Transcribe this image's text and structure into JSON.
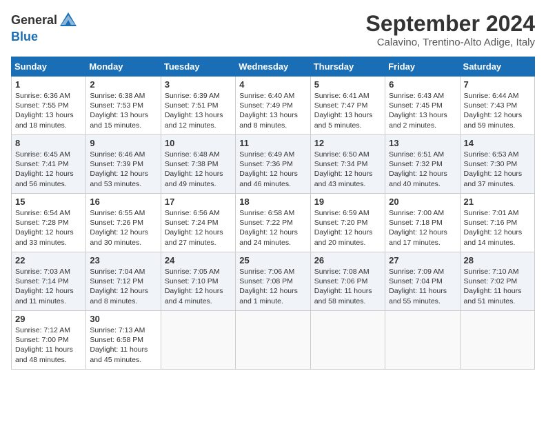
{
  "header": {
    "logo_line1": "General",
    "logo_line2": "Blue",
    "month_title": "September 2024",
    "location": "Calavino, Trentino-Alto Adige, Italy"
  },
  "weekdays": [
    "Sunday",
    "Monday",
    "Tuesday",
    "Wednesday",
    "Thursday",
    "Friday",
    "Saturday"
  ],
  "weeks": [
    [
      {
        "day": "1",
        "lines": [
          "Sunrise: 6:36 AM",
          "Sunset: 7:55 PM",
          "Daylight: 13 hours",
          "and 18 minutes."
        ]
      },
      {
        "day": "2",
        "lines": [
          "Sunrise: 6:38 AM",
          "Sunset: 7:53 PM",
          "Daylight: 13 hours",
          "and 15 minutes."
        ]
      },
      {
        "day": "3",
        "lines": [
          "Sunrise: 6:39 AM",
          "Sunset: 7:51 PM",
          "Daylight: 13 hours",
          "and 12 minutes."
        ]
      },
      {
        "day": "4",
        "lines": [
          "Sunrise: 6:40 AM",
          "Sunset: 7:49 PM",
          "Daylight: 13 hours",
          "and 8 minutes."
        ]
      },
      {
        "day": "5",
        "lines": [
          "Sunrise: 6:41 AM",
          "Sunset: 7:47 PM",
          "Daylight: 13 hours",
          "and 5 minutes."
        ]
      },
      {
        "day": "6",
        "lines": [
          "Sunrise: 6:43 AM",
          "Sunset: 7:45 PM",
          "Daylight: 13 hours",
          "and 2 minutes."
        ]
      },
      {
        "day": "7",
        "lines": [
          "Sunrise: 6:44 AM",
          "Sunset: 7:43 PM",
          "Daylight: 12 hours",
          "and 59 minutes."
        ]
      }
    ],
    [
      {
        "day": "8",
        "lines": [
          "Sunrise: 6:45 AM",
          "Sunset: 7:41 PM",
          "Daylight: 12 hours",
          "and 56 minutes."
        ]
      },
      {
        "day": "9",
        "lines": [
          "Sunrise: 6:46 AM",
          "Sunset: 7:39 PM",
          "Daylight: 12 hours",
          "and 53 minutes."
        ]
      },
      {
        "day": "10",
        "lines": [
          "Sunrise: 6:48 AM",
          "Sunset: 7:38 PM",
          "Daylight: 12 hours",
          "and 49 minutes."
        ]
      },
      {
        "day": "11",
        "lines": [
          "Sunrise: 6:49 AM",
          "Sunset: 7:36 PM",
          "Daylight: 12 hours",
          "and 46 minutes."
        ]
      },
      {
        "day": "12",
        "lines": [
          "Sunrise: 6:50 AM",
          "Sunset: 7:34 PM",
          "Daylight: 12 hours",
          "and 43 minutes."
        ]
      },
      {
        "day": "13",
        "lines": [
          "Sunrise: 6:51 AM",
          "Sunset: 7:32 PM",
          "Daylight: 12 hours",
          "and 40 minutes."
        ]
      },
      {
        "day": "14",
        "lines": [
          "Sunrise: 6:53 AM",
          "Sunset: 7:30 PM",
          "Daylight: 12 hours",
          "and 37 minutes."
        ]
      }
    ],
    [
      {
        "day": "15",
        "lines": [
          "Sunrise: 6:54 AM",
          "Sunset: 7:28 PM",
          "Daylight: 12 hours",
          "and 33 minutes."
        ]
      },
      {
        "day": "16",
        "lines": [
          "Sunrise: 6:55 AM",
          "Sunset: 7:26 PM",
          "Daylight: 12 hours",
          "and 30 minutes."
        ]
      },
      {
        "day": "17",
        "lines": [
          "Sunrise: 6:56 AM",
          "Sunset: 7:24 PM",
          "Daylight: 12 hours",
          "and 27 minutes."
        ]
      },
      {
        "day": "18",
        "lines": [
          "Sunrise: 6:58 AM",
          "Sunset: 7:22 PM",
          "Daylight: 12 hours",
          "and 24 minutes."
        ]
      },
      {
        "day": "19",
        "lines": [
          "Sunrise: 6:59 AM",
          "Sunset: 7:20 PM",
          "Daylight: 12 hours",
          "and 20 minutes."
        ]
      },
      {
        "day": "20",
        "lines": [
          "Sunrise: 7:00 AM",
          "Sunset: 7:18 PM",
          "Daylight: 12 hours",
          "and 17 minutes."
        ]
      },
      {
        "day": "21",
        "lines": [
          "Sunrise: 7:01 AM",
          "Sunset: 7:16 PM",
          "Daylight: 12 hours",
          "and 14 minutes."
        ]
      }
    ],
    [
      {
        "day": "22",
        "lines": [
          "Sunrise: 7:03 AM",
          "Sunset: 7:14 PM",
          "Daylight: 12 hours",
          "and 11 minutes."
        ]
      },
      {
        "day": "23",
        "lines": [
          "Sunrise: 7:04 AM",
          "Sunset: 7:12 PM",
          "Daylight: 12 hours",
          "and 8 minutes."
        ]
      },
      {
        "day": "24",
        "lines": [
          "Sunrise: 7:05 AM",
          "Sunset: 7:10 PM",
          "Daylight: 12 hours",
          "and 4 minutes."
        ]
      },
      {
        "day": "25",
        "lines": [
          "Sunrise: 7:06 AM",
          "Sunset: 7:08 PM",
          "Daylight: 12 hours",
          "and 1 minute."
        ]
      },
      {
        "day": "26",
        "lines": [
          "Sunrise: 7:08 AM",
          "Sunset: 7:06 PM",
          "Daylight: 11 hours",
          "and 58 minutes."
        ]
      },
      {
        "day": "27",
        "lines": [
          "Sunrise: 7:09 AM",
          "Sunset: 7:04 PM",
          "Daylight: 11 hours",
          "and 55 minutes."
        ]
      },
      {
        "day": "28",
        "lines": [
          "Sunrise: 7:10 AM",
          "Sunset: 7:02 PM",
          "Daylight: 11 hours",
          "and 51 minutes."
        ]
      }
    ],
    [
      {
        "day": "29",
        "lines": [
          "Sunrise: 7:12 AM",
          "Sunset: 7:00 PM",
          "Daylight: 11 hours",
          "and 48 minutes."
        ]
      },
      {
        "day": "30",
        "lines": [
          "Sunrise: 7:13 AM",
          "Sunset: 6:58 PM",
          "Daylight: 11 hours",
          "and 45 minutes."
        ]
      },
      {
        "day": "",
        "lines": []
      },
      {
        "day": "",
        "lines": []
      },
      {
        "day": "",
        "lines": []
      },
      {
        "day": "",
        "lines": []
      },
      {
        "day": "",
        "lines": []
      }
    ]
  ]
}
